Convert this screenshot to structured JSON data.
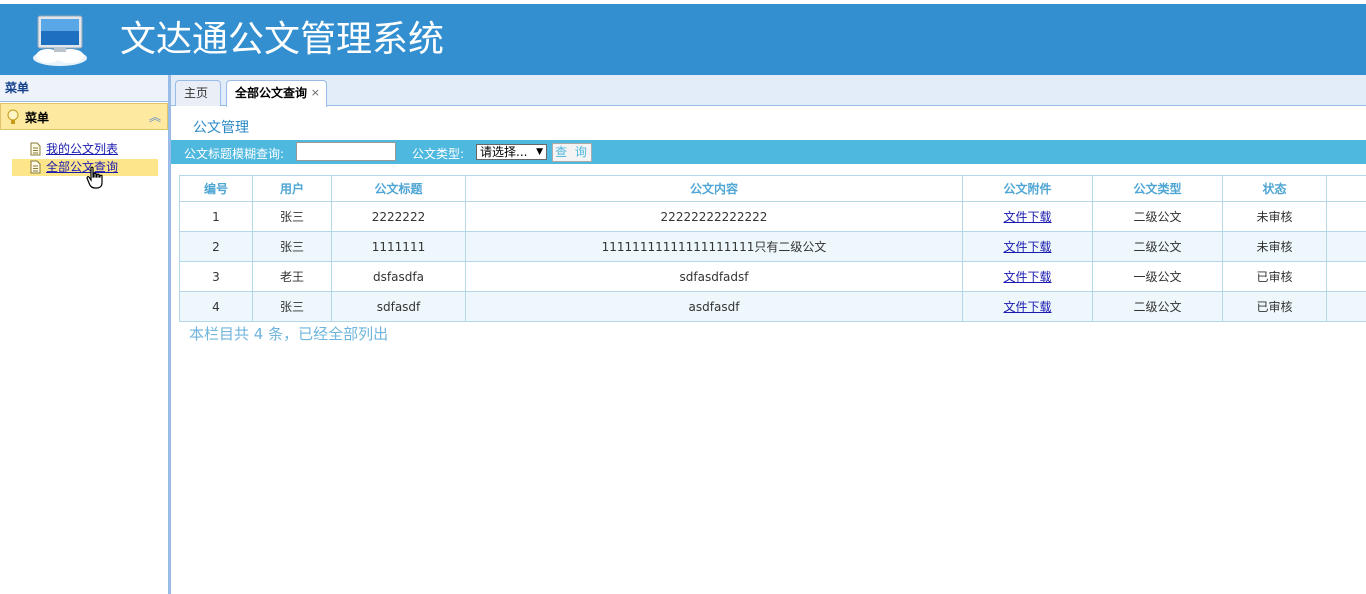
{
  "app": {
    "title": "文达通公文管理系统"
  },
  "west": {
    "panel_title": "菜单",
    "accordion_title": "菜单",
    "items": [
      {
        "label": "我的公文列表"
      },
      {
        "label": "全部公文查询"
      }
    ]
  },
  "tabs": [
    {
      "label": "主页"
    },
    {
      "label": "全部公文查询",
      "close": "×"
    }
  ],
  "section_title": "公文管理",
  "search": {
    "title_label": "公文标题模糊查询:",
    "title_value": "",
    "type_label": "公文类型:",
    "type_selected": "请选择...",
    "button": "查 询"
  },
  "table": {
    "headers": [
      "编号",
      "用户",
      "公文标题",
      "公文内容",
      "公文附件",
      "公文类型",
      "状态"
    ],
    "rows": [
      {
        "id": "1",
        "user": "张三",
        "title": "2222222",
        "content": "22222222222222",
        "attachment": "文件下载",
        "type": "二级公文",
        "status": "未审核"
      },
      {
        "id": "2",
        "user": "张三",
        "title": "1111111",
        "content": "11111111111111111111只有二级公文",
        "attachment": "文件下载",
        "type": "二级公文",
        "status": "未审核"
      },
      {
        "id": "3",
        "user": "老王",
        "title": "dsfasdfa",
        "content": "sdfasdfadsf",
        "attachment": "文件下载",
        "type": "一级公文",
        "status": "已审核"
      },
      {
        "id": "4",
        "user": "张三",
        "title": "sdfasdf",
        "content": "asdfasdf",
        "attachment": "文件下载",
        "type": "二级公文",
        "status": "已审核"
      }
    ]
  },
  "summary": "本栏目共 4 条，已经全部列出",
  "colors": {
    "header_bg": "#338fcf",
    "accent": "#4fb8df",
    "menu_highlight": "#fde68a"
  }
}
